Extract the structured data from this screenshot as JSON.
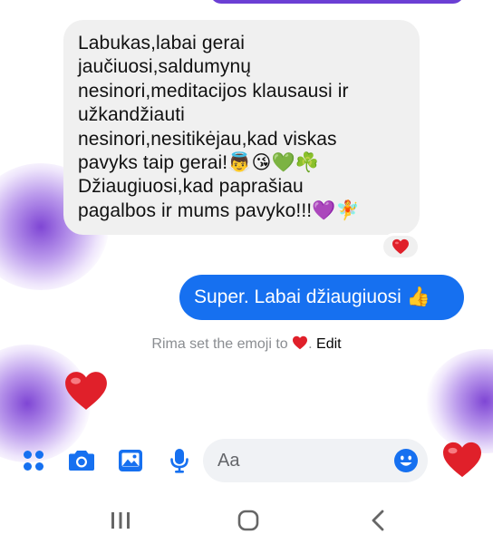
{
  "thread": {
    "incoming_message": "Labukas,labai gerai\njaučiuosi,saldumynų\nnesinori,meditacijos klausausi ir\nužkandžiauti\nnesinori,nesitikėjau,kad viskas\npavyks taip gerai!👼😘💚☘️\nDžiaugiuosi,kad paprašiau\npagalbos ir mums pavyko!!!💜🧚",
    "incoming_reaction": "heart-reaction",
    "outgoing_message": "Super. Labai džiaugiuosi",
    "outgoing_emoji": "👍",
    "system_prefix": "Rima set the emoji to",
    "system_suffix": ".",
    "system_action": "Edit",
    "sent_emoji": "heart"
  },
  "composer": {
    "placeholder": "Aa",
    "icons": [
      "apps-icon",
      "camera-icon",
      "gallery-icon",
      "microphone-icon",
      "emoji-icon",
      "heart-send-icon"
    ]
  },
  "navbar": {
    "icons": [
      "recents-icon",
      "home-icon",
      "back-icon"
    ]
  },
  "colors": {
    "accent_blue": "#1670f0",
    "incoming_bg": "#f0f0f0",
    "heart_red": "#e0202a",
    "blur_purple": "#7a3cd2",
    "system_text": "#8a8d91"
  }
}
